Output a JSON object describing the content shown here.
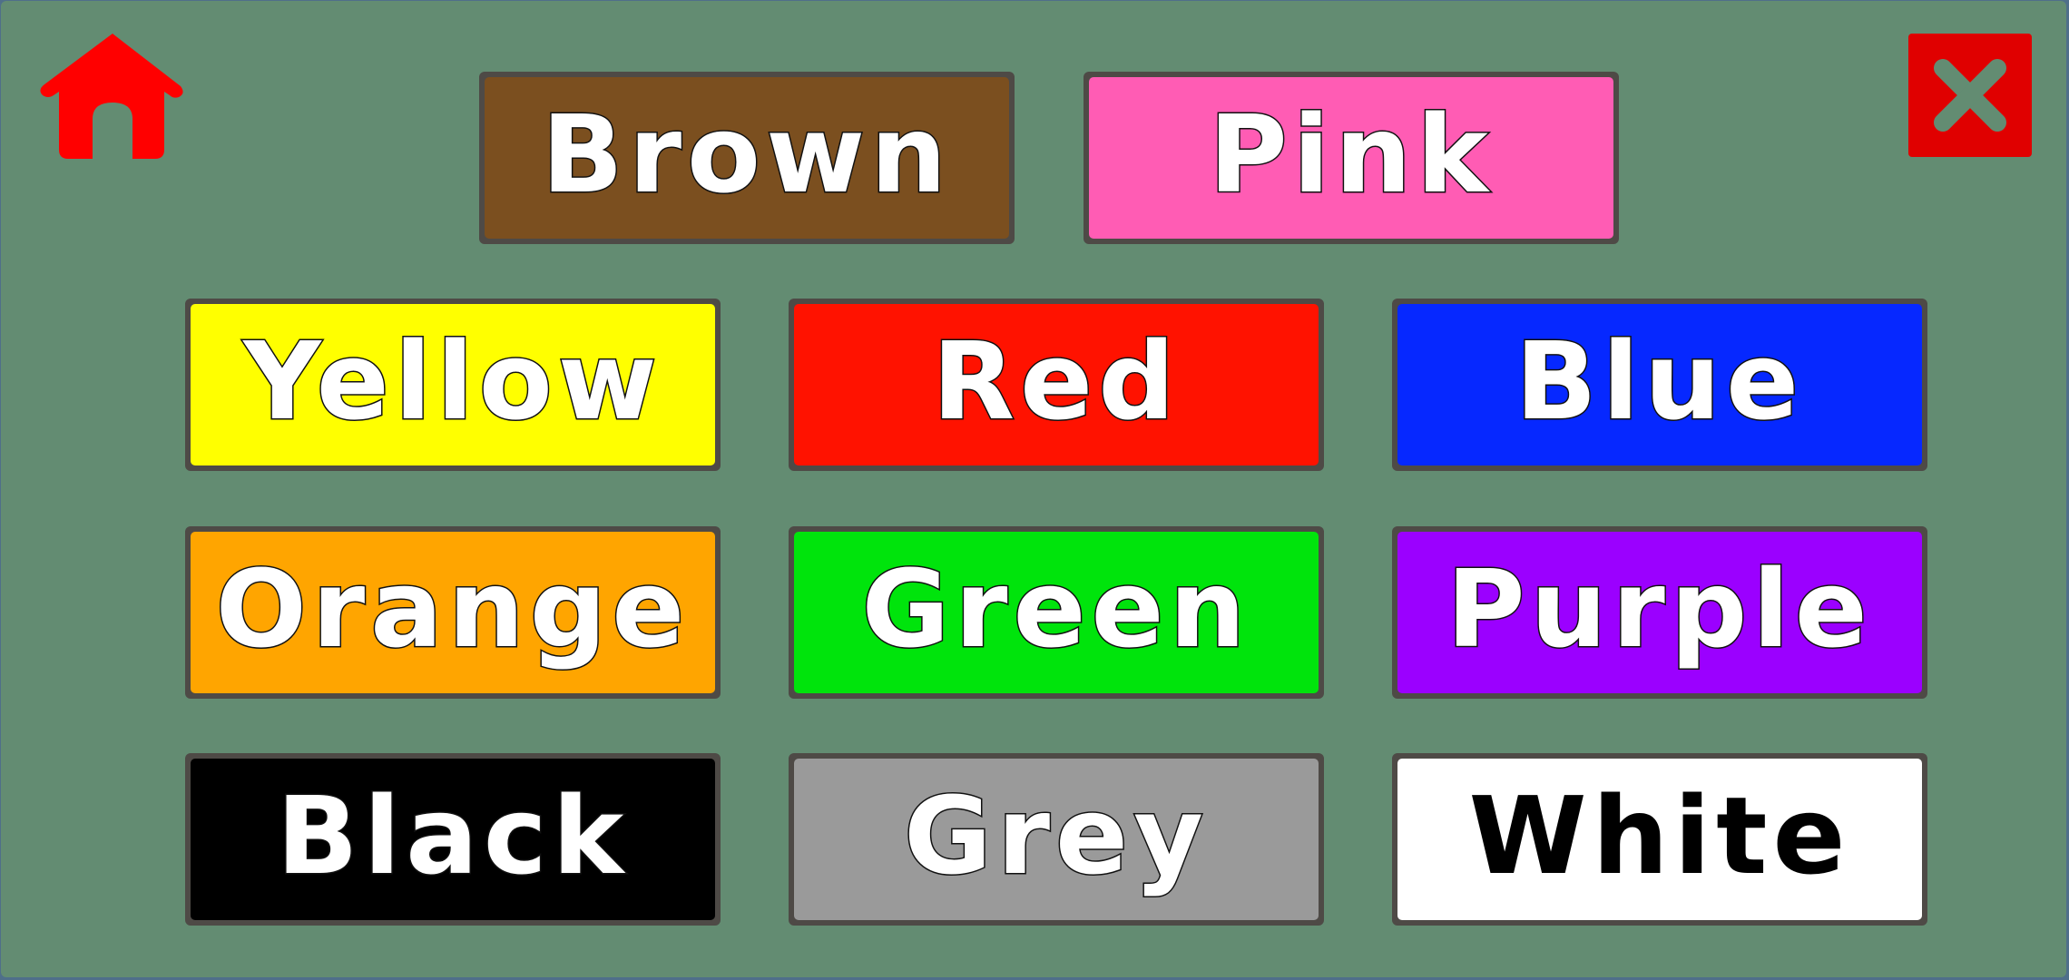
{
  "nav": {
    "home_icon": "home-icon",
    "close_icon": "close-icon",
    "home_color": "#ff0000",
    "close_color": "#e00000"
  },
  "colors": [
    {
      "label": "Brown",
      "fill": "#7b4f1f",
      "text_color": "#ffffff"
    },
    {
      "label": "Pink",
      "fill": "#ff5cb4",
      "text_color": "#ffffff"
    },
    {
      "label": "Yellow",
      "fill": "#ffff00",
      "text_color": "#ffffff"
    },
    {
      "label": "Red",
      "fill": "#ff1200",
      "text_color": "#ffffff"
    },
    {
      "label": "Blue",
      "fill": "#0628ff",
      "text_color": "#ffffff"
    },
    {
      "label": "Orange",
      "fill": "#ffa500",
      "text_color": "#ffffff"
    },
    {
      "label": "Green",
      "fill": "#00e40c",
      "text_color": "#ffffff"
    },
    {
      "label": "Purple",
      "fill": "#9b00ff",
      "text_color": "#ffffff"
    },
    {
      "label": "Black",
      "fill": "#000000",
      "text_color": "#ffffff"
    },
    {
      "label": "Grey",
      "fill": "#9a9a9a",
      "text_color": "#ffffff"
    },
    {
      "label": "White",
      "fill": "#ffffff",
      "text_color": "#000000"
    }
  ]
}
